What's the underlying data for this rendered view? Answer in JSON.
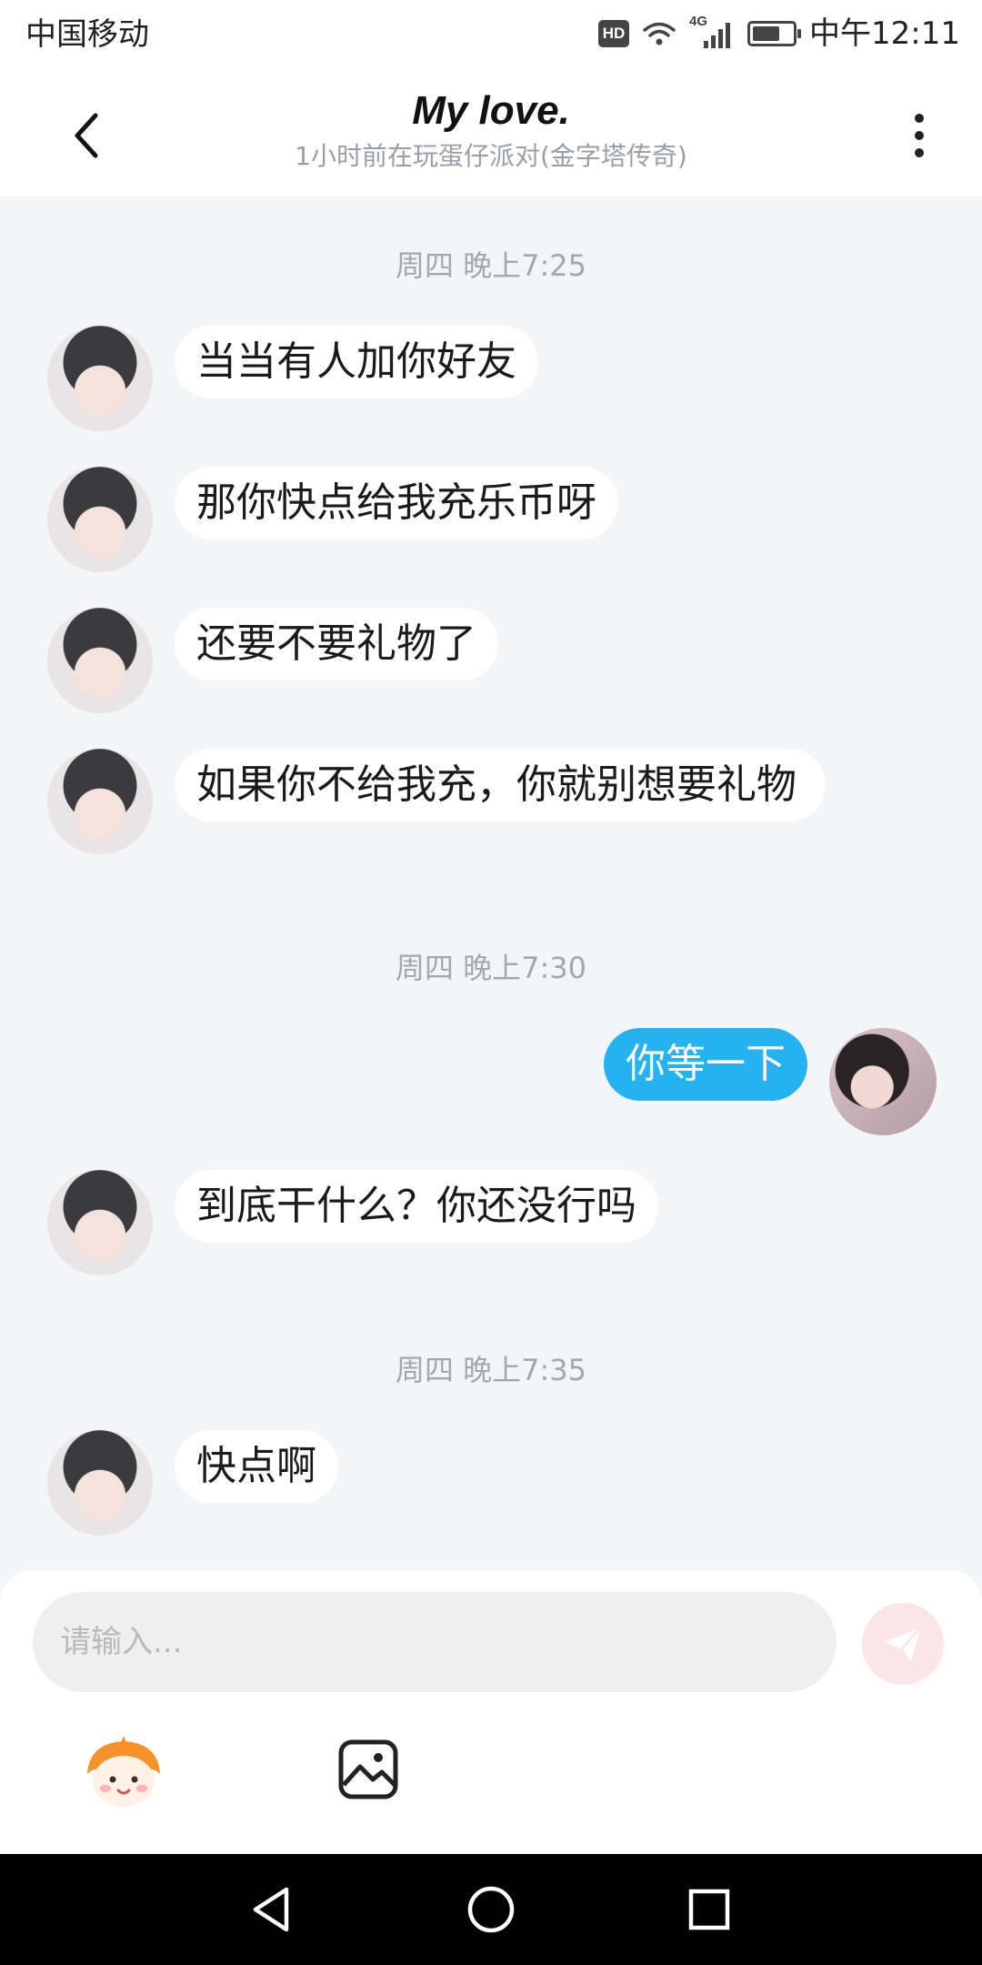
{
  "status_bar": {
    "carrier": "中国移动",
    "hd": "HD",
    "network": "4G",
    "time": "中午12:11"
  },
  "header": {
    "title": "My love.",
    "subtitle": "1小时前在玩蛋仔派对(金字塔传奇)"
  },
  "messages": {
    "timestamps": [
      "周四 晚上7:25",
      "周四 晚上7:30",
      "周四 晚上7:35"
    ],
    "items": [
      "当当有人加你好友",
      "那你快点给我充乐币呀",
      "还要不要礼物了",
      "如果你不给我充，你就别想要礼物",
      "你等一下",
      "到底干什么？你还没行吗",
      "快点啊"
    ]
  },
  "input": {
    "placeholder": "请输入..."
  },
  "colors": {
    "self_bubble": "#25b2f0",
    "send_button": "#fde5e5",
    "chat_background": "#f4f5f7"
  },
  "icons": {
    "back": "chevron-left-icon",
    "more": "more-vertical-icon",
    "send": "send-icon",
    "emoji": "mascot-emoji-icon",
    "image": "image-icon"
  }
}
